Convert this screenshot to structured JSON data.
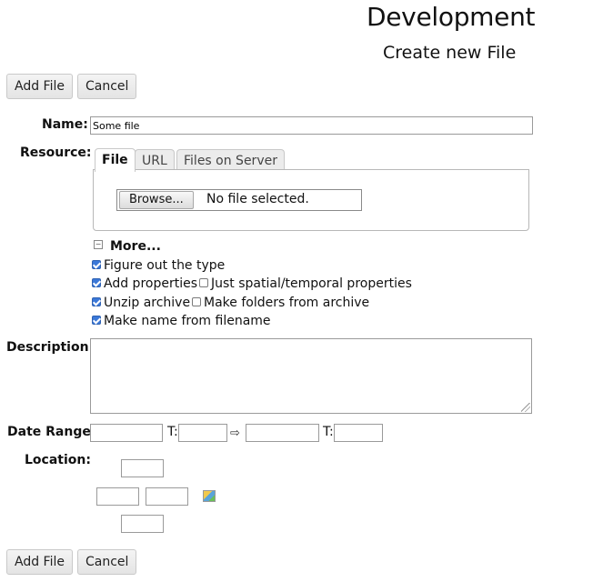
{
  "header": {
    "title": "Development",
    "subtitle": "Create new File"
  },
  "actions": {
    "add_label": "Add File",
    "cancel_label": "Cancel"
  },
  "form": {
    "name": {
      "label": "Name:",
      "value": "Some file"
    },
    "resource": {
      "label": "Resource:",
      "tabs": [
        {
          "label": "File"
        },
        {
          "label": "URL"
        },
        {
          "label": "Files on Server"
        }
      ],
      "active_tab": "File",
      "browse_label": "Browse...",
      "file_status": "No file selected."
    },
    "more": {
      "label": "More..."
    },
    "options": {
      "figure_type": {
        "label": "Figure out the type",
        "checked": true
      },
      "add_properties": {
        "label": "Add properties",
        "checked": true
      },
      "spatial_only": {
        "label": "Just spatial/temporal properties",
        "checked": false
      },
      "unzip": {
        "label": "Unzip archive",
        "checked": true
      },
      "make_folders": {
        "label": "Make folders from archive",
        "checked": false
      },
      "name_from_filename": {
        "label": "Make name from filename",
        "checked": true
      }
    },
    "description": {
      "label": "Description:",
      "value": ""
    },
    "date_range": {
      "label": "Date Range:",
      "time_label": "T:",
      "from_date": "",
      "from_time": "",
      "to_date": "",
      "to_time": ""
    },
    "location": {
      "label": "Location:",
      "north": "",
      "west": "",
      "east": "",
      "south": ""
    }
  },
  "icons": {
    "more_toggle": "minus-box-icon",
    "range_arrow": "right-arrow-icon",
    "map_picker": "map-icon",
    "resize": "resize-grip-icon"
  }
}
